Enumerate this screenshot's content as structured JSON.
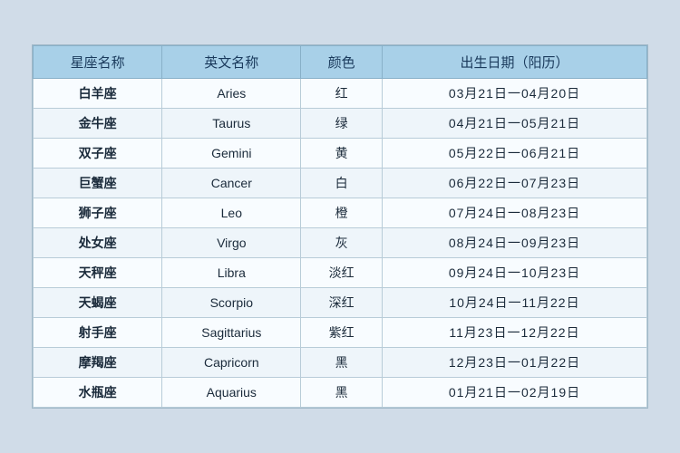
{
  "table": {
    "headers": [
      {
        "key": "col1",
        "label": "星座名称"
      },
      {
        "key": "col2",
        "label": "英文名称"
      },
      {
        "key": "col3",
        "label": "颜色"
      },
      {
        "key": "col4",
        "label": "出生日期（阳历）"
      }
    ],
    "rows": [
      {
        "chinese": "白羊座",
        "english": "Aries",
        "color": "红",
        "dates": "03月21日一04月20日"
      },
      {
        "chinese": "金牛座",
        "english": "Taurus",
        "color": "绿",
        "dates": "04月21日一05月21日"
      },
      {
        "chinese": "双子座",
        "english": "Gemini",
        "color": "黄",
        "dates": "05月22日一06月21日"
      },
      {
        "chinese": "巨蟹座",
        "english": "Cancer",
        "color": "白",
        "dates": "06月22日一07月23日"
      },
      {
        "chinese": "狮子座",
        "english": "Leo",
        "color": "橙",
        "dates": "07月24日一08月23日"
      },
      {
        "chinese": "处女座",
        "english": "Virgo",
        "color": "灰",
        "dates": "08月24日一09月23日"
      },
      {
        "chinese": "天秤座",
        "english": "Libra",
        "color": "淡红",
        "dates": "09月24日一10月23日"
      },
      {
        "chinese": "天蝎座",
        "english": "Scorpio",
        "color": "深红",
        "dates": "10月24日一11月22日"
      },
      {
        "chinese": "射手座",
        "english": "Sagittarius",
        "color": "紫红",
        "dates": "11月23日一12月22日"
      },
      {
        "chinese": "摩羯座",
        "english": "Capricorn",
        "color": "黑",
        "dates": "12月23日一01月22日"
      },
      {
        "chinese": "水瓶座",
        "english": "Aquarius",
        "color": "黑",
        "dates": "01月21日一02月19日"
      }
    ]
  }
}
